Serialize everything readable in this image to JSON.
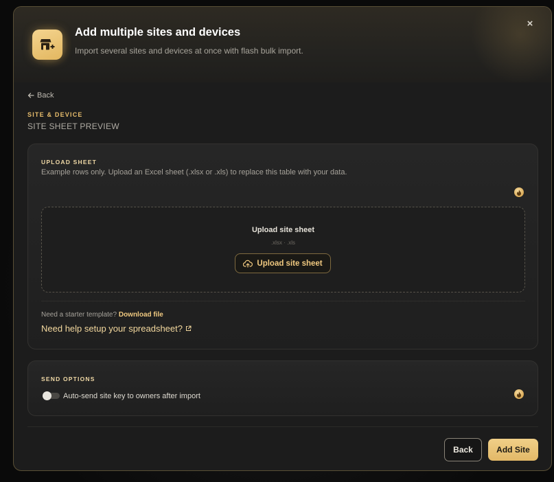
{
  "modal": {
    "title": "Add multiple sites and devices",
    "subtitle": "Import several sites and devices at once with flash bulk import.",
    "header_icon": "storefront-add-icon",
    "close_label": "×"
  },
  "nav": {
    "back_label": "Back",
    "back_icon": "arrow-left-icon"
  },
  "section": {
    "kicker": "SITE & DEVICE",
    "title": "SITE SHEET PREVIEW"
  },
  "upload_card": {
    "kicker": "UPLOAD SHEET",
    "description": "Example rows only. Upload an Excel sheet (.xlsx or .xls) to replace this table with your data.",
    "info_icon": "flame-info-icon",
    "dropzone": {
      "title": "Upload site sheet",
      "types": ".xlsx · .xls",
      "button_label": "Upload site sheet",
      "button_icon": "cloud-upload-icon"
    },
    "template_prompt": "Need a starter template?",
    "template_link": "Download file",
    "help_link": "Need help setup your spreadsheet?",
    "help_icon": "external-link-icon"
  },
  "send_card": {
    "kicker": "SEND OPTIONS",
    "toggle_label": "Auto-send site key to owners after import",
    "toggle_on": false,
    "info_icon": "flame-info-icon"
  },
  "footer": {
    "back_label": "Back",
    "add_label": "Add Site"
  },
  "colors": {
    "accent": "#e8bd6c",
    "accent_button": "#f0cf88",
    "background": "#1c1c1c",
    "border": "#5a5036"
  }
}
